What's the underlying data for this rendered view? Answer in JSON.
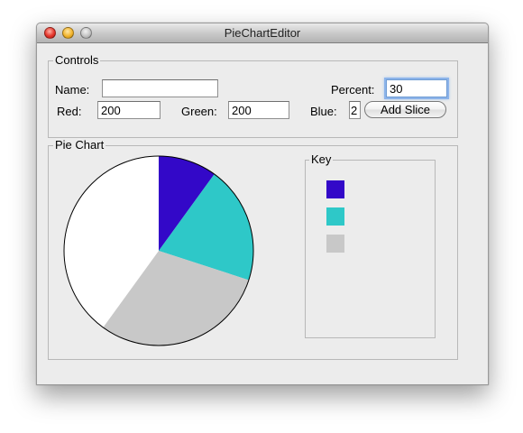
{
  "window": {
    "title": "PieChartEditor"
  },
  "controls": {
    "panel_title": "Controls",
    "name_label": "Name:",
    "name_value": "",
    "percent_label": "Percent:",
    "percent_value": "30",
    "red_label": "Red:",
    "red_value": "200",
    "green_label": "Green:",
    "green_value": "200",
    "blue_label": "Blue:",
    "blue_value": "2",
    "add_slice_label": "Add Slice"
  },
  "pie_chart": {
    "panel_title": "Pie Chart",
    "key_title": "Key",
    "key_colors": [
      "#3308c8",
      "#2ec8c8",
      "#c8c8c8"
    ]
  },
  "chart_data": {
    "type": "pie",
    "slices": [
      {
        "value": 10,
        "color": "#3308c8"
      },
      {
        "value": 20,
        "color": "#2ec8c8"
      },
      {
        "value": 30,
        "color": "#c8c8c8"
      },
      {
        "value": 40,
        "color": "#ffffff"
      }
    ],
    "start_angle_deg": 0,
    "direction": "clockwise-from-top"
  }
}
